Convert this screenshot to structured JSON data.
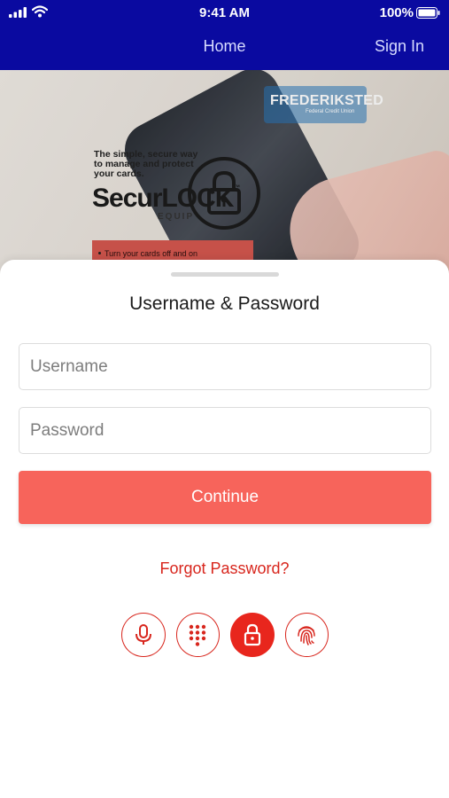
{
  "status_bar": {
    "time": "9:41 AM",
    "battery": "100%"
  },
  "nav": {
    "title": "Home",
    "sign_in": "Sign In"
  },
  "banner": {
    "logo": "FREDERIKSTED",
    "logo_sub": "Federal Credit Union",
    "tagline": "The simple, secure way to manage and protect your cards.",
    "brand": "SecurLOCK",
    "brand_tm": "™",
    "brand_sub": "EQUIP",
    "bullet": "Turn your cards off and on"
  },
  "login": {
    "title": "Username & Password",
    "username_placeholder": "Username",
    "password_placeholder": "Password",
    "continue_label": "Continue",
    "forgot_label": "Forgot Password?"
  },
  "auth_methods": [
    {
      "icon": "microphone-icon",
      "active": false
    },
    {
      "icon": "keypad-icon",
      "active": false
    },
    {
      "icon": "lock-icon",
      "active": true
    },
    {
      "icon": "fingerprint-icon",
      "active": false
    }
  ],
  "colors": {
    "nav_bg": "#0a0aa0",
    "accent": "#f7645b",
    "link": "#d8261d"
  }
}
